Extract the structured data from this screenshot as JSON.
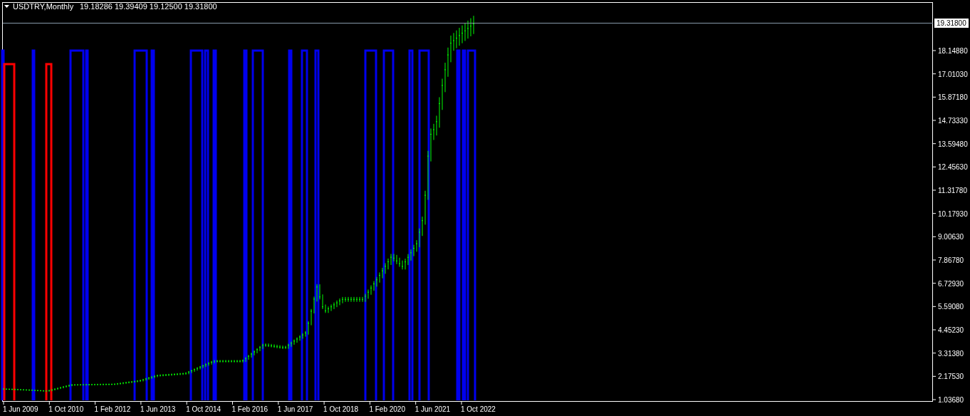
{
  "chart": {
    "symbol": "USDTRY,Monthly",
    "ohlc": "19.18286 19.39409 19.12500 19.31800",
    "price_label": "19.31800",
    "y_axis_labels": [
      "18.14880",
      "17.01030",
      "15.87180",
      "14.73330",
      "13.59480",
      "12.45630",
      "11.31780",
      "10.17930",
      "9.00630",
      "7.86780",
      "6.72930",
      "5.59080",
      "4.45230",
      "3.31380",
      "2.17530",
      "1.03680"
    ],
    "x_axis_labels": [
      "1 Jun 2009",
      "1 Oct 2010",
      "1 Feb 2012",
      "1 Jun 2013",
      "1 Oct 2014",
      "1 Feb 2016",
      "1 Jun 2017",
      "1 Oct 2018",
      "1 Feb 2020",
      "1 Jun 2021",
      "1 Oct 2022"
    ]
  }
}
